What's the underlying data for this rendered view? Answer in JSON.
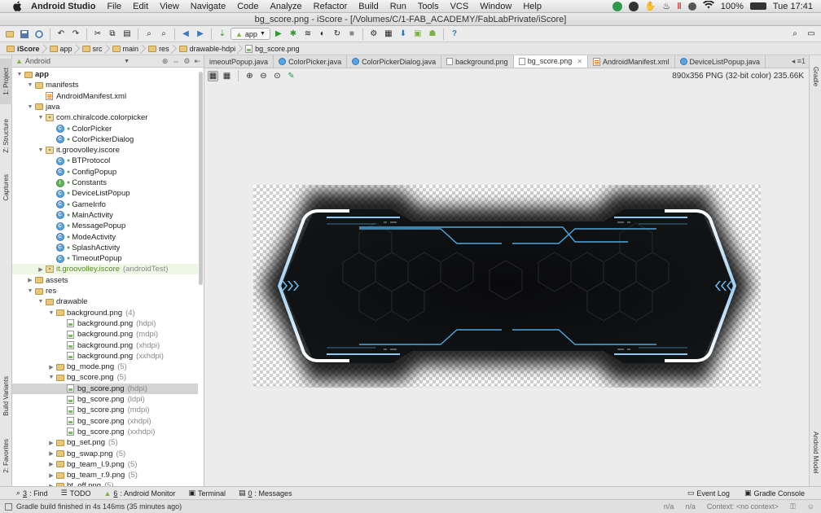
{
  "menubar": {
    "app_name": "Android Studio",
    "items": [
      "File",
      "Edit",
      "View",
      "Navigate",
      "Code",
      "Analyze",
      "Refactor",
      "Build",
      "Run",
      "Tools",
      "VCS",
      "Window",
      "Help"
    ],
    "battery": "100%",
    "clock": "Tue 17:41"
  },
  "window": {
    "title": "bg_score.png - iScore - [/Volumes/C/1-FAB_ACADEMY/FabLabPrivate/iScore]"
  },
  "toolbar": {
    "run_config": "app"
  },
  "breadcrumb": [
    "iScore",
    "app",
    "src",
    "main",
    "res",
    "drawable-hdpi",
    "bg_score.png"
  ],
  "project_panel": {
    "view_mode": "Android",
    "tree": [
      {
        "label": "app",
        "indent": 0,
        "arrow": "▼",
        "icon": "folder",
        "bold": true
      },
      {
        "label": "manifests",
        "indent": 1,
        "arrow": "▼",
        "icon": "folder"
      },
      {
        "label": "AndroidManifest.xml",
        "indent": 2,
        "arrow": "",
        "icon": "xml"
      },
      {
        "label": "java",
        "indent": 1,
        "arrow": "▼",
        "icon": "folder"
      },
      {
        "label": "com.chiralcode.colorpicker",
        "indent": 2,
        "arrow": "▼",
        "icon": "package"
      },
      {
        "label": "ColorPicker",
        "indent": 3,
        "arrow": "",
        "icon": "class"
      },
      {
        "label": "ColorPickerDialog",
        "indent": 3,
        "arrow": "",
        "icon": "class"
      },
      {
        "label": "it.groovolley.iscore",
        "indent": 2,
        "arrow": "▼",
        "icon": "package"
      },
      {
        "label": "BTProtocol",
        "indent": 3,
        "arrow": "",
        "icon": "class"
      },
      {
        "label": "ConfigPopup",
        "indent": 3,
        "arrow": "",
        "icon": "class"
      },
      {
        "label": "Constants",
        "indent": 3,
        "arrow": "",
        "icon": "interface"
      },
      {
        "label": "DeviceListPopup",
        "indent": 3,
        "arrow": "",
        "icon": "class"
      },
      {
        "label": "GameInfo",
        "indent": 3,
        "arrow": "",
        "icon": "class"
      },
      {
        "label": "MainActivity",
        "indent": 3,
        "arrow": "",
        "icon": "class"
      },
      {
        "label": "MessagePopup",
        "indent": 3,
        "arrow": "",
        "icon": "class"
      },
      {
        "label": "ModeActivity",
        "indent": 3,
        "arrow": "",
        "icon": "class"
      },
      {
        "label": "SplashActivity",
        "indent": 3,
        "arrow": "",
        "icon": "class"
      },
      {
        "label": "TimeoutPopup",
        "indent": 3,
        "arrow": "",
        "icon": "class"
      },
      {
        "label": "it.groovolley.iscore",
        "suffix": "(androidTest)",
        "indent": 2,
        "arrow": "▶",
        "icon": "package",
        "test": true
      },
      {
        "label": "assets",
        "indent": 1,
        "arrow": "▶",
        "icon": "folder"
      },
      {
        "label": "res",
        "indent": 1,
        "arrow": "▼",
        "icon": "folder"
      },
      {
        "label": "drawable",
        "indent": 2,
        "arrow": "▼",
        "icon": "folder"
      },
      {
        "label": "background.png",
        "suffix": "(4)",
        "indent": 3,
        "arrow": "▼",
        "icon": "folder"
      },
      {
        "label": "background.png",
        "suffix": "(hdpi)",
        "indent": 4,
        "arrow": "",
        "icon": "image"
      },
      {
        "label": "background.png",
        "suffix": "(mdpi)",
        "indent": 4,
        "arrow": "",
        "icon": "image"
      },
      {
        "label": "background.png",
        "suffix": "(xhdpi)",
        "indent": 4,
        "arrow": "",
        "icon": "image"
      },
      {
        "label": "background.png",
        "suffix": "(xxhdpi)",
        "indent": 4,
        "arrow": "",
        "icon": "image"
      },
      {
        "label": "bg_mode.png",
        "suffix": "(5)",
        "indent": 3,
        "arrow": "▶",
        "icon": "folder"
      },
      {
        "label": "bg_score.png",
        "suffix": "(5)",
        "indent": 3,
        "arrow": "▼",
        "icon": "folder"
      },
      {
        "label": "bg_score.png",
        "suffix": "(hdpi)",
        "indent": 4,
        "arrow": "",
        "icon": "image",
        "selected": true
      },
      {
        "label": "bg_score.png",
        "suffix": "(ldpi)",
        "indent": 4,
        "arrow": "",
        "icon": "image"
      },
      {
        "label": "bg_score.png",
        "suffix": "(mdpi)",
        "indent": 4,
        "arrow": "",
        "icon": "image"
      },
      {
        "label": "bg_score.png",
        "suffix": "(xhdpi)",
        "indent": 4,
        "arrow": "",
        "icon": "image"
      },
      {
        "label": "bg_score.png",
        "suffix": "(xxhdpi)",
        "indent": 4,
        "arrow": "",
        "icon": "image"
      },
      {
        "label": "bg_set.png",
        "suffix": "(5)",
        "indent": 3,
        "arrow": "▶",
        "icon": "folder"
      },
      {
        "label": "bg_swap.png",
        "suffix": "(5)",
        "indent": 3,
        "arrow": "▶",
        "icon": "folder"
      },
      {
        "label": "bg_team_l.9.png",
        "suffix": "(5)",
        "indent": 3,
        "arrow": "▶",
        "icon": "folder"
      },
      {
        "label": "bg_team_r.9.png",
        "suffix": "(5)",
        "indent": 3,
        "arrow": "▶",
        "icon": "folder"
      },
      {
        "label": "bt_off.png",
        "suffix": "(5)",
        "indent": 3,
        "arrow": "▶",
        "icon": "folder"
      }
    ]
  },
  "editor_tabs": [
    {
      "label": "imeoutPopup.java",
      "icon": "class",
      "active": false
    },
    {
      "label": "ColorPicker.java",
      "icon": "class",
      "active": false
    },
    {
      "label": "ColorPickerDialog.java",
      "icon": "class",
      "active": false
    },
    {
      "label": "background.png",
      "icon": "image",
      "active": false
    },
    {
      "label": "bg_score.png",
      "icon": "image",
      "active": true
    },
    {
      "label": "AndroidManifest.xml",
      "icon": "xml",
      "active": false
    },
    {
      "label": "DeviceListPopup.java",
      "icon": "class",
      "active": false
    }
  ],
  "tabs_more": "◂ ≡1",
  "image_info": "890x356 PNG (32-bit color) 235.66K",
  "left_tool_tabs": {
    "project": "1: Project",
    "structure": "Z: Structure",
    "captures": "Captures",
    "build_variants": "Build Variants",
    "favorites": "2: Favorites"
  },
  "right_tool_tabs": {
    "gradle": "Gradle",
    "android_model": "Android Model"
  },
  "bottom_tools": [
    {
      "num": "3",
      "label": ": Find"
    },
    {
      "num": "",
      "label": "TODO"
    },
    {
      "num": "6",
      "label": ": Android Monitor"
    },
    {
      "num": "",
      "label": "Terminal"
    },
    {
      "num": "0",
      "label": ": Messages"
    }
  ],
  "bottom_right": [
    "Event Log",
    "Gradle Console"
  ],
  "status": {
    "message": "Gradle build finished in 4s 146ms (35 minutes ago)",
    "na1": "n/a",
    "na2": "n/a",
    "context": "Context: <no context>"
  }
}
